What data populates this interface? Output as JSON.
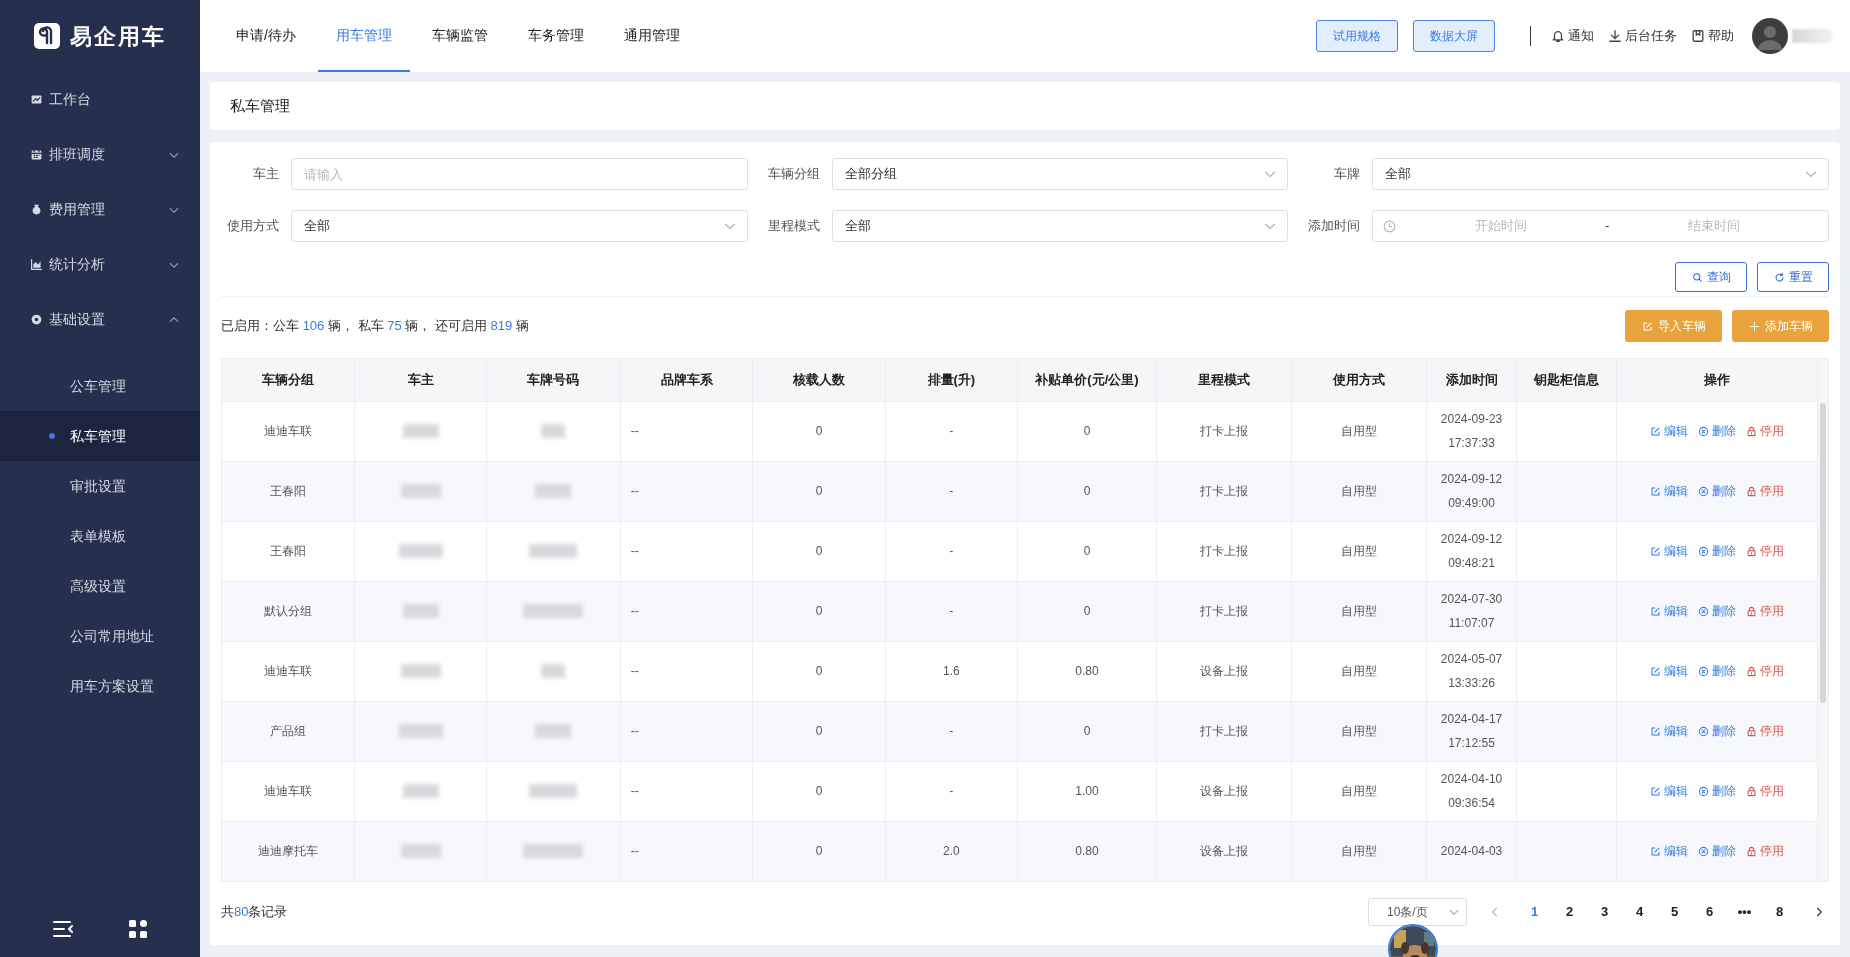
{
  "logo": {
    "text": "易企用车"
  },
  "sidebar": {
    "items": [
      {
        "label": "工作台",
        "kind": "link"
      },
      {
        "label": "排班调度",
        "kind": "group",
        "expanded": false
      },
      {
        "label": "费用管理",
        "kind": "group",
        "expanded": false
      },
      {
        "label": "统计分析",
        "kind": "group",
        "expanded": false
      },
      {
        "label": "基础设置",
        "kind": "group",
        "expanded": true,
        "children": [
          {
            "label": "公车管理",
            "selected": false
          },
          {
            "label": "私车管理",
            "selected": true
          },
          {
            "label": "审批设置",
            "selected": false
          },
          {
            "label": "表单模板",
            "selected": false
          },
          {
            "label": "高级设置",
            "selected": false
          },
          {
            "label": "公司常用地址",
            "selected": false
          },
          {
            "label": "用车方案设置",
            "selected": false
          }
        ]
      }
    ]
  },
  "top_nav": {
    "tabs": [
      {
        "label": "申请/待办",
        "selected": false
      },
      {
        "label": "用车管理",
        "selected": true
      },
      {
        "label": "车辆监管",
        "selected": false
      },
      {
        "label": "车务管理",
        "selected": false
      },
      {
        "label": "通用管理",
        "selected": false
      }
    ],
    "buttons": [
      "试用规格",
      "数据大屏"
    ],
    "tools": [
      "通知",
      "后台任务",
      "帮助"
    ]
  },
  "page_title": "私车管理",
  "filters": [
    {
      "label": "车主",
      "kind": "text",
      "placeholder": "请输入"
    },
    {
      "label": "车辆分组",
      "kind": "select",
      "value": "全部分组"
    },
    {
      "label": "车牌",
      "kind": "select",
      "value": "全部"
    },
    {
      "label": "使用方式",
      "kind": "select",
      "value": "全部"
    },
    {
      "label": "里程模式",
      "kind": "select",
      "value": "全部"
    },
    {
      "label": "添加时间",
      "kind": "daterange",
      "start_placeholder": "开始时间",
      "separator": "-",
      "end_placeholder": "结束时间"
    }
  ],
  "filter_buttons": [
    "查询",
    "重置"
  ],
  "summary": [
    {
      "text": "已启用：公车 ",
      "highlight": false
    },
    {
      "text": "106",
      "highlight": true
    },
    {
      "text": " 辆， 私车 ",
      "highlight": false
    },
    {
      "text": "75",
      "highlight": true
    },
    {
      "text": " 辆， 还可启用 ",
      "highlight": false
    },
    {
      "text": "819",
      "highlight": true
    },
    {
      "text": " 辆",
      "highlight": false
    }
  ],
  "table_buttons": [
    "导入车辆",
    "添加车辆"
  ],
  "table": {
    "columns": [
      "车辆分组",
      "车主",
      "车牌号码",
      "品牌车系",
      "核载人数",
      "排量(升)",
      "补贴单价(元/公里)",
      "里程模式",
      "使用方式",
      "添加时间",
      "钥匙柜信息",
      "操作"
    ],
    "rows": [
      {
        "group": "迪迪车联",
        "brand": "--",
        "seats": "0",
        "displacement": "-",
        "subsidy": "0",
        "mileage_mode": "打卡上报",
        "usage": "自用型",
        "added": [
          "2024-09-23",
          "17:37:33"
        ],
        "actions": [
          "编辑",
          "删除",
          "停用"
        ]
      },
      {
        "group": "王春阳",
        "brand": "--",
        "seats": "0",
        "displacement": "-",
        "subsidy": "0",
        "mileage_mode": "打卡上报",
        "usage": "自用型",
        "added": [
          "2024-09-12",
          "09:49:00"
        ],
        "actions": [
          "编辑",
          "删除",
          "停用"
        ]
      },
      {
        "group": "王春阳",
        "brand": "--",
        "seats": "0",
        "displacement": "-",
        "subsidy": "0",
        "mileage_mode": "打卡上报",
        "usage": "自用型",
        "added": [
          "2024-09-12",
          "09:48:21"
        ],
        "actions": [
          "编辑",
          "删除",
          "停用"
        ]
      },
      {
        "group": "默认分组",
        "brand": "--",
        "seats": "0",
        "displacement": "-",
        "subsidy": "0",
        "mileage_mode": "打卡上报",
        "usage": "自用型",
        "added": [
          "2024-07-30",
          "11:07:07"
        ],
        "actions": [
          "编辑",
          "删除",
          "停用"
        ]
      },
      {
        "group": "迪迪车联",
        "brand": "--",
        "seats": "0",
        "displacement": "1.6",
        "subsidy": "0.80",
        "mileage_mode": "设备上报",
        "usage": "自用型",
        "added": [
          "2024-05-07",
          "13:33:26"
        ],
        "actions": [
          "编辑",
          "删除",
          "停用"
        ]
      },
      {
        "group": "产品组",
        "brand": "--",
        "seats": "0",
        "displacement": "-",
        "subsidy": "0",
        "mileage_mode": "打卡上报",
        "usage": "自用型",
        "added": [
          "2024-04-17",
          "17:12:55"
        ],
        "actions": [
          "编辑",
          "删除",
          "停用"
        ]
      },
      {
        "group": "迪迪车联",
        "brand": "--",
        "seats": "0",
        "displacement": "-",
        "subsidy": "1.00",
        "mileage_mode": "设备上报",
        "usage": "自用型",
        "added": [
          "2024-04-10",
          "09:36:54"
        ],
        "actions": [
          "编辑",
          "删除",
          "停用"
        ]
      },
      {
        "group": "迪迪摩托车",
        "brand": "--",
        "seats": "0",
        "displacement": "2.0",
        "subsidy": "0.80",
        "mileage_mode": "设备上报",
        "usage": "自用型",
        "added": [
          "2024-04-03"
        ],
        "actions": [
          "编辑",
          "删除",
          "停用"
        ]
      }
    ]
  },
  "pagination": {
    "total_prefix": "共",
    "total": "80",
    "total_suffix": "条记录",
    "page_size": "10条/页",
    "pages": [
      {
        "label": "1",
        "selected": true
      },
      {
        "label": "2",
        "selected": false
      },
      {
        "label": "3",
        "selected": false
      },
      {
        "label": "4",
        "selected": false
      },
      {
        "label": "5",
        "selected": false
      },
      {
        "label": "6",
        "selected": false
      },
      {
        "label": "•••",
        "selected": false
      },
      {
        "label": "8",
        "selected": false
      }
    ]
  }
}
